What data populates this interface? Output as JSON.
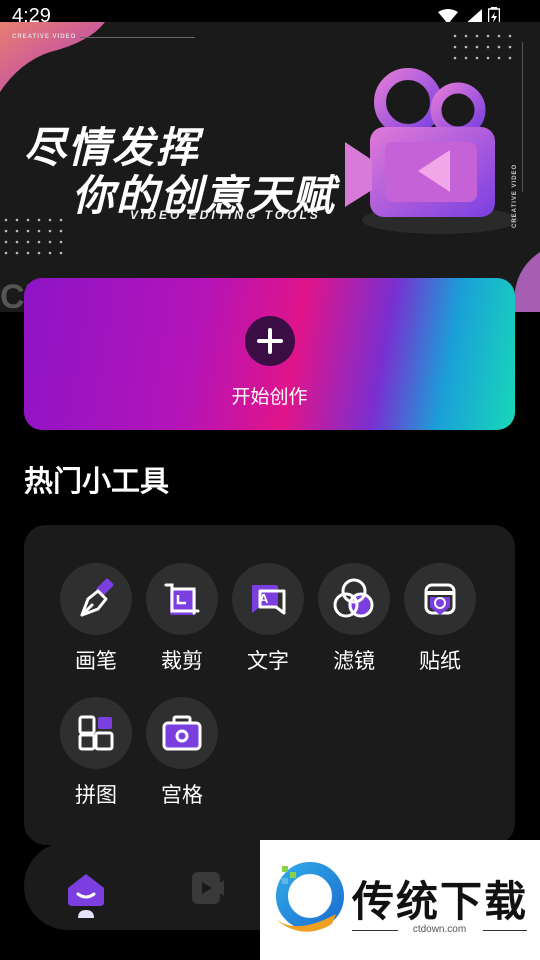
{
  "status_bar": {
    "time": "4:29"
  },
  "banner": {
    "small_label": "CREATIVE VIDEO",
    "title_line1": "尽情发挥",
    "title_line2": "你的创意天赋",
    "subtitle": "VIDEO EDITING TOOLS",
    "vertical_label": "CREATIVE VIDEO",
    "corner_text": "CR"
  },
  "start_card": {
    "label": "开始创作"
  },
  "section": {
    "title": "热门小工具"
  },
  "tools": [
    {
      "label": "画笔",
      "icon": "brush-icon"
    },
    {
      "label": "裁剪",
      "icon": "crop-icon"
    },
    {
      "label": "文字",
      "icon": "text-icon"
    },
    {
      "label": "滤镜",
      "icon": "filter-icon"
    },
    {
      "label": "贴纸",
      "icon": "sticker-icon"
    },
    {
      "label": "拼图",
      "icon": "collage-icon"
    },
    {
      "label": "宫格",
      "icon": "grid-icon"
    }
  ],
  "bottom_nav": {
    "items": [
      {
        "icon": "home-icon"
      },
      {
        "icon": "video-icon"
      }
    ]
  },
  "watermark": {
    "brand": "传统下载",
    "url": "ctdown.com"
  },
  "colors": {
    "accent": "#6b2fd6",
    "panel": "#1b1b1b",
    "icon_bg": "#2f2f2f"
  }
}
